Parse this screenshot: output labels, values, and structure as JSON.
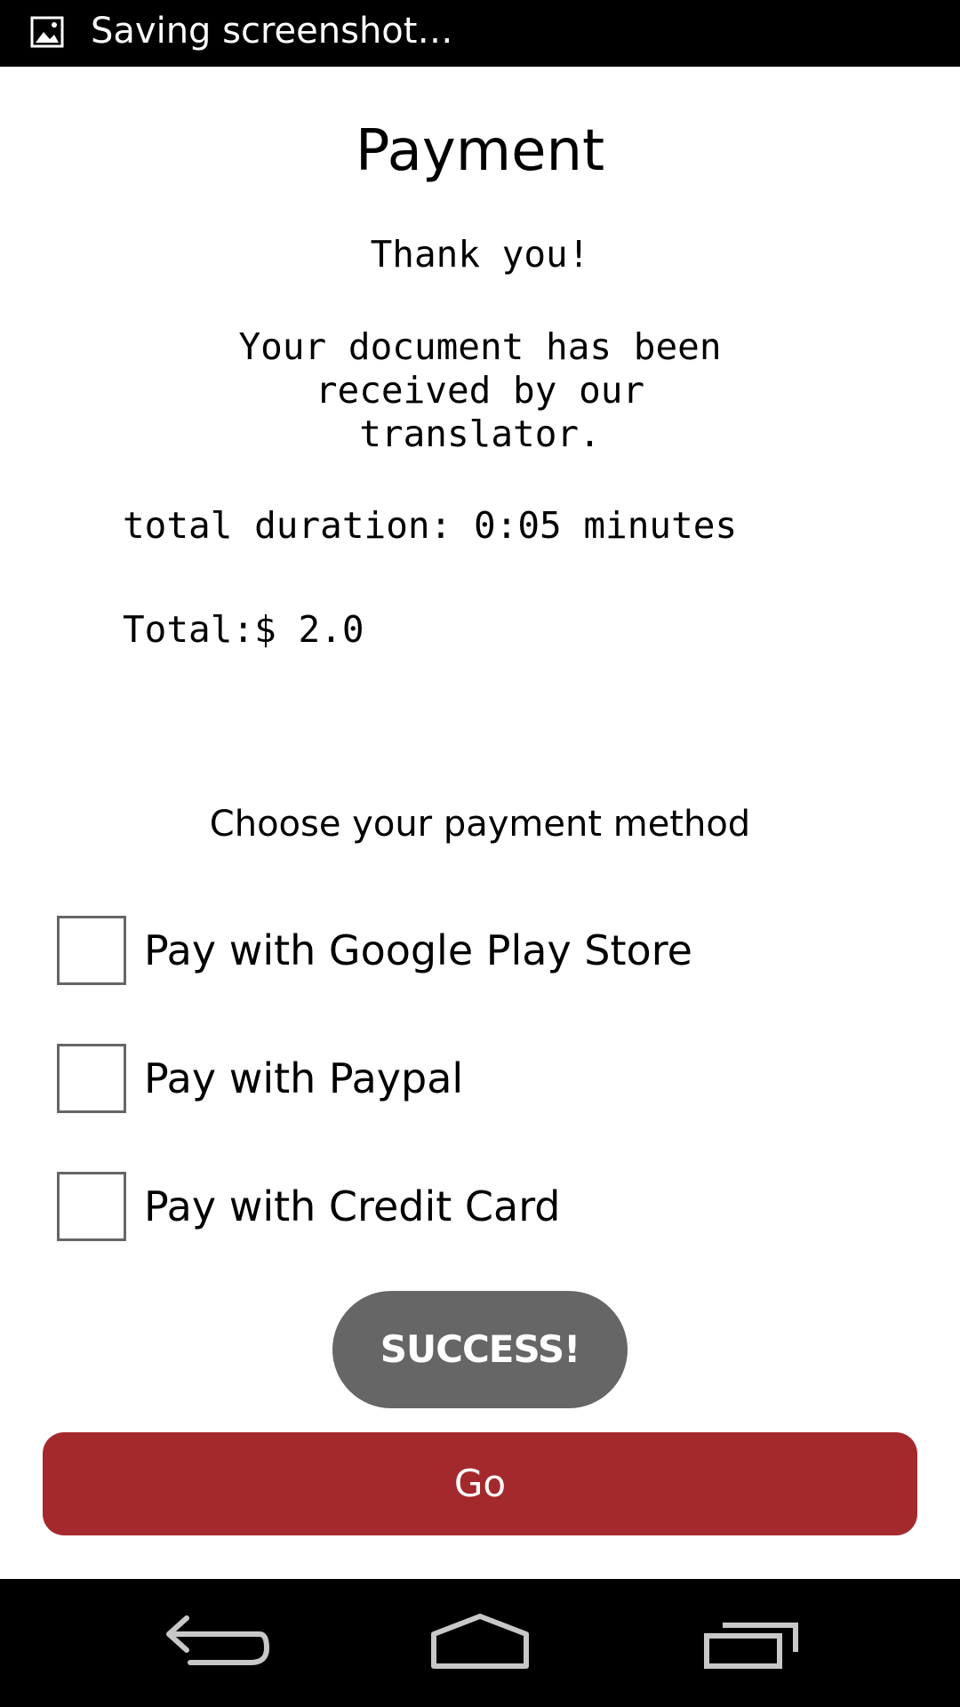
{
  "status_bar": {
    "notification_icon": "image-icon",
    "text": "Saving screenshot…"
  },
  "page": {
    "title": "Payment",
    "thanks": "Thank you!",
    "message": "Your document has been received by our translator.",
    "duration": "total duration: 0:05 minutes",
    "total": "Total:$ 2.0",
    "choose_prompt": "Choose your payment method"
  },
  "payment_options": [
    {
      "label": "Pay with Google Play Store",
      "checked": false
    },
    {
      "label": "Pay with Paypal",
      "checked": false
    },
    {
      "label": "Pay with Credit Card",
      "checked": false
    }
  ],
  "toast": {
    "text": "SUCCESS!"
  },
  "go_button": {
    "label": "Go",
    "color": "#a4292d"
  },
  "nav_bar": {
    "back_icon": "back-icon",
    "home_icon": "home-icon",
    "recents_icon": "recents-icon"
  }
}
